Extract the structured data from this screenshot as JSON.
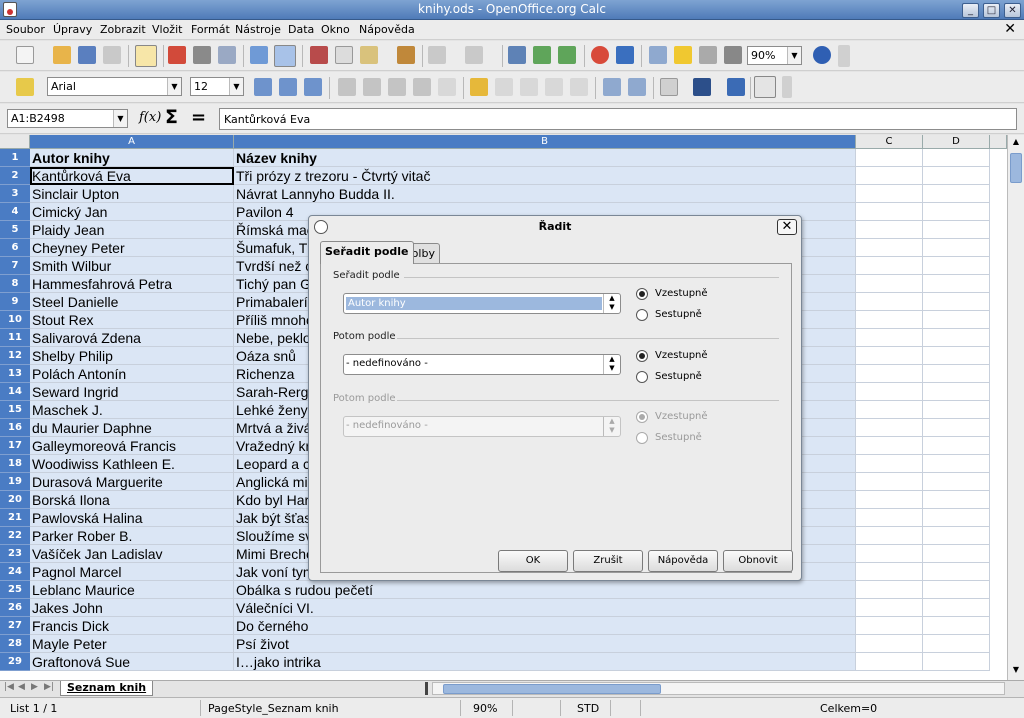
{
  "window": {
    "title": "knihy.ods - OpenOffice.org Calc",
    "minimize": "_",
    "maximize": "□",
    "close": "✕"
  },
  "menu": [
    "Soubor",
    "Úpravy",
    "Zobrazit",
    "Vložit",
    "Formát",
    "Nástroje",
    "Data",
    "Okno",
    "Nápověda"
  ],
  "menu_close": "✕",
  "formatting": {
    "font": "Arial",
    "size": "12",
    "zoom": "90%"
  },
  "formula_bar": {
    "cell_ref": "A1:B2498",
    "func_symbol": "f(x)",
    "sum_symbol": "Σ",
    "equals_symbol": "=",
    "content": "Kantůrková Eva"
  },
  "columns": [
    "A",
    "B",
    "C",
    "D"
  ],
  "rows": [
    {
      "n": "1",
      "a": "Autor knihy",
      "b": "Název knihy"
    },
    {
      "n": "2",
      "a": "Kantůrková Eva",
      "b": "Tři prózy z trezoru - Čtvrtý vitač"
    },
    {
      "n": "3",
      "a": "Sinclair Upton",
      "b": "Návrat Lannyho Budda II."
    },
    {
      "n": "4",
      "a": "Cimický Jan",
      "b": "Pavilon 4"
    },
    {
      "n": "5",
      "a": "Plaidy Jean",
      "b": "Římská mac"
    },
    {
      "n": "6",
      "a": "Cheyney Peter",
      "b": "Šumafuk, T"
    },
    {
      "n": "7",
      "a": "Smith Wilbur",
      "b": "Tvrdší než c"
    },
    {
      "n": "8",
      "a": "Hammesfahrová Petra",
      "b": "Tichý pan G"
    },
    {
      "n": "9",
      "a": "Steel Danielle",
      "b": "Primabalerín"
    },
    {
      "n": "10",
      "a": "Stout Rex",
      "b": "Příliš mnoho"
    },
    {
      "n": "11",
      "a": "Salivarová Zdena",
      "b": "Nebe, peklo"
    },
    {
      "n": "12",
      "a": "Shelby Philip",
      "b": "Oáza snů"
    },
    {
      "n": "13",
      "a": "Polách Antonín",
      "b": "Richenza"
    },
    {
      "n": "14",
      "a": "Seward Ingrid",
      "b": "Sarah-Rerg"
    },
    {
      "n": "15",
      "a": "Maschek J.",
      "b": "Lehké ženy"
    },
    {
      "n": "16",
      "a": "du Maurier Daphne",
      "b": "Mrtvá a živá"
    },
    {
      "n": "17",
      "a": "Galleymoreová Francis",
      "b": "Vražedný kr"
    },
    {
      "n": "18",
      "a": "Woodiwiss Kathleen E.",
      "b": "Leopard a c"
    },
    {
      "n": "19",
      "a": "Durasová Marguerite",
      "b": "Anglická mil"
    },
    {
      "n": "20",
      "a": "Borská Ilona",
      "b": "Kdo byl Har"
    },
    {
      "n": "21",
      "a": "Pawlovská Halina",
      "b": "Jak být šťas"
    },
    {
      "n": "22",
      "a": "Parker Rober B.",
      "b": "Sloužíme sv"
    },
    {
      "n": "23",
      "a": "Vašíček Jan Ladislav",
      "b": "Mimi Breche"
    },
    {
      "n": "24",
      "a": "Pagnol Marcel",
      "b": "Jak voní tym"
    },
    {
      "n": "25",
      "a": "Leblanc Maurice",
      "b": "Obálka s rudou pečetí"
    },
    {
      "n": "26",
      "a": "Jakes John",
      "b": "Válečníci VI."
    },
    {
      "n": "27",
      "a": "Francis Dick",
      "b": "Do černého"
    },
    {
      "n": "28",
      "a": "Mayle Peter",
      "b": "Psí život"
    },
    {
      "n": "29",
      "a": "Graftonová Sue",
      "b": "I…jako intrika"
    }
  ],
  "sheet_tab": "Seznam knih",
  "status": {
    "sheet": "List 1 / 1",
    "style": "PageStyle_Seznam knih",
    "zoom": "90%",
    "mode": "STD",
    "sum": "Celkem=0"
  },
  "dialog": {
    "title": "Řadit",
    "tabs": [
      "Seřadit podle",
      "Volby"
    ],
    "sort1": {
      "label": "Seřadit podle",
      "value": "Autor knihy",
      "asc": "Vzestupně",
      "desc": "Sestupně"
    },
    "sort2": {
      "label": "Potom podle",
      "value": "- nedefinováno -",
      "asc": "Vzestupně",
      "desc": "Sestupně"
    },
    "sort3": {
      "label": "Potom podle",
      "value": "- nedefinováno -",
      "asc": "Vzestupně",
      "desc": "Sestupně"
    },
    "buttons": {
      "ok": "OK",
      "cancel": "Zrušit",
      "help": "Nápověda",
      "reset": "Obnovit"
    }
  },
  "colors": {
    "row_header": "#4a7cc4",
    "selection": "#dbe6f5",
    "title_bar": "#4f7bb8"
  }
}
